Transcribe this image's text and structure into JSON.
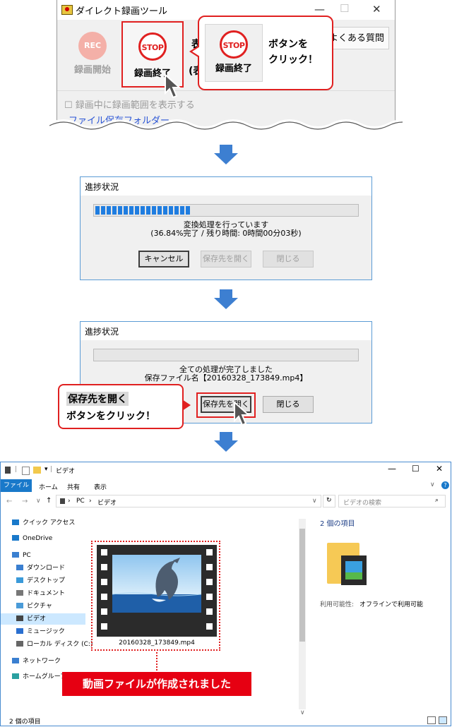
{
  "panel1": {
    "window_title": "ダイレクト録画ツール",
    "rec_icon_text": "REC",
    "rec_button_label": "録画開始",
    "stop_icon_text": "STOP",
    "stop_button_label": "録画終了",
    "partial_label_1": "表",
    "partial_label_2": "(表",
    "faq_button_label": "よくある質問",
    "checkbox_label": "録画中に録画範囲を表示する",
    "folder_link": "ファイル保存フォルダー",
    "bubble_text": "ボタンを\nクリック！"
  },
  "dialog1": {
    "title": "進捗状況",
    "progress_fraction": 0.36,
    "status_line1": "変換処理を行っています",
    "status_line2": "(36.84%完了 / 残り時間: 0時間00分03秒)",
    "cancel_label": "キャンセル",
    "open_folder_label": "保存先を開く",
    "close_label": "閉じる"
  },
  "dialog2": {
    "title": "進捗状況",
    "progress_fraction": 0,
    "status_line1": "全ての処理が完了しました",
    "status_line2": "保存ファイル名【20160328_173849.mp4】",
    "open_folder_label": "保存先を開く",
    "close_label": "閉じる",
    "callout_line1": "保存先を開く",
    "callout_line2": "ボタンをクリック！"
  },
  "explorer": {
    "window_title": "ビデオ",
    "ribbon_tabs": [
      "ファイル",
      "ホーム",
      "共有",
      "表示"
    ],
    "breadcrumb": [
      "PC",
      "ビデオ"
    ],
    "search_placeholder": "ビデオの検索",
    "nav_items": [
      "クイック アクセス",
      "OneDrive",
      "PC",
      "ダウンロード",
      "デスクトップ",
      "ドキュメント",
      "ピクチャ",
      "ビデオ",
      "ミュージック",
      "ローカル ディスク (C:)",
      "ネットワーク",
      "ホームグループ"
    ],
    "file_name": "20160328_173849.mp4",
    "details_count": "2 個の項目",
    "availability_label": "利用可能性:",
    "availability_value": "オフラインで利用可能",
    "status_bar": "2 個の項目",
    "annotation": "動画ファイルが作成されました"
  },
  "colors": {
    "accent_red": "#e02020",
    "label_red": "#e60012",
    "progress_blue": "#1f7de0",
    "arrow_blue": "#3d7fd1",
    "ribbon_blue": "#1979ca"
  }
}
